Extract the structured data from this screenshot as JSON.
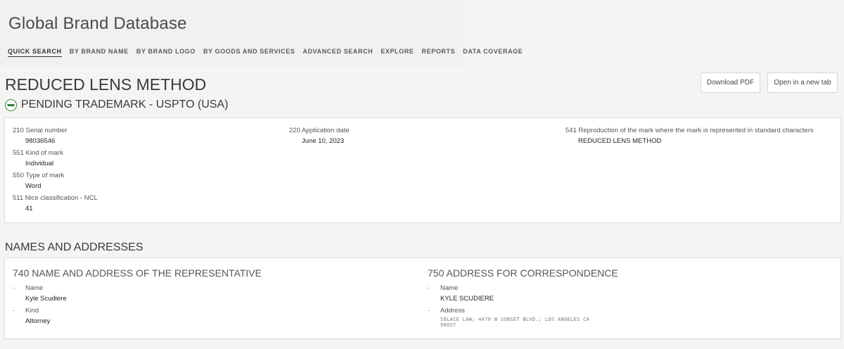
{
  "app": {
    "title": "Global Brand Database"
  },
  "nav": {
    "items": [
      "QUICK SEARCH",
      "BY BRAND NAME",
      "BY BRAND LOGO",
      "BY GOODS AND SERVICES",
      "ADVANCED SEARCH",
      "EXPLORE",
      "REPORTS",
      "DATA COVERAGE"
    ],
    "active": "QUICK SEARCH"
  },
  "record": {
    "title": "REDUCED LENS METHOD",
    "status": "PENDING TRADEMARK - USPTO (USA)",
    "status_icon": "folder-open-icon",
    "status_color": "#2e7d32"
  },
  "actions": {
    "download_pdf": "Download PDF",
    "open_new_tab": "Open in a new tab"
  },
  "details": {
    "serial": {
      "label": "210 Serial number",
      "value": "98036546"
    },
    "kind": {
      "label": "551 Kind of mark",
      "value": "Individual"
    },
    "type": {
      "label": "550 Type of mark",
      "value": "Word"
    },
    "nice": {
      "label": "511 Nice classification - NCL",
      "value": "41"
    },
    "app_date": {
      "label": "220 Application date",
      "value": "June 10, 2023"
    },
    "reproduction": {
      "label": "541 Reproduction of the mark where the mark is represented in standard characters",
      "value": "REDUCED LENS METHOD"
    }
  },
  "names": {
    "section_title": "NAMES AND ADDRESSES",
    "representative": {
      "title": "740 NAME AND ADDRESS OF THE REPRESENTATIVE",
      "name_label": "Name",
      "name_value": "Kyle Scudiere",
      "kind_label": "Kind",
      "kind_value": "Attorney"
    },
    "correspondence": {
      "title": "750 ADDRESS FOR CORRESPONDENCE",
      "name_label": "Name",
      "name_value": "KYLE SCUDIERE",
      "address_label": "Address",
      "address_value": "SOLACE LAW; 4470 W SUNSET BLVD.; LOS ANGELES CA 90027"
    }
  }
}
